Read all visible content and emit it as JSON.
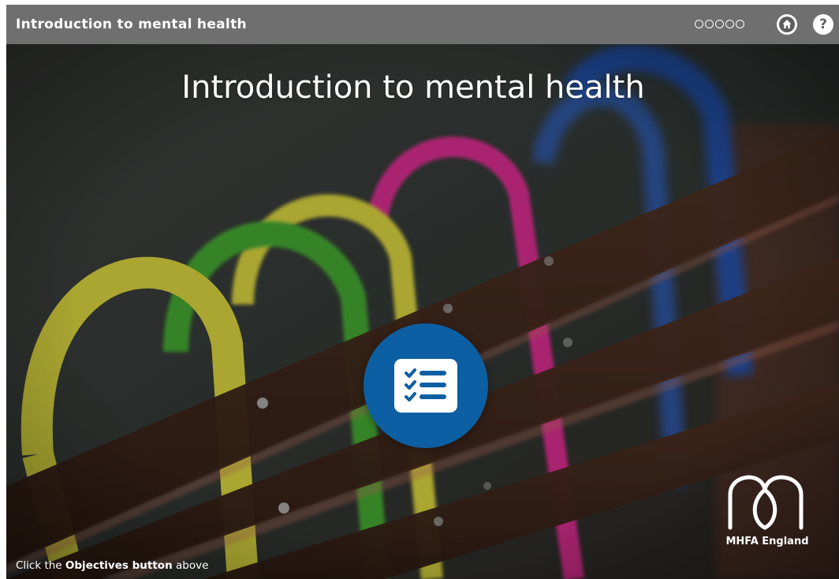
{
  "header": {
    "title": "Introduction to mental health",
    "progress_total": 5,
    "progress_completed": 0,
    "home_icon": "home-icon",
    "help_icon": "help-icon",
    "help_glyph": "?"
  },
  "main": {
    "title": "Introduction to mental health",
    "objectives_icon": "checklist-icon",
    "objectives_color": "#0d5fa3"
  },
  "logo": {
    "name": "MHFA England"
  },
  "footer": {
    "instruction_prefix": "Click the",
    "instruction_bold": "Objectives button",
    "instruction_suffix": "above"
  },
  "colors": {
    "topbar": "#6f6f6f",
    "accent": "#0d5fa3"
  }
}
